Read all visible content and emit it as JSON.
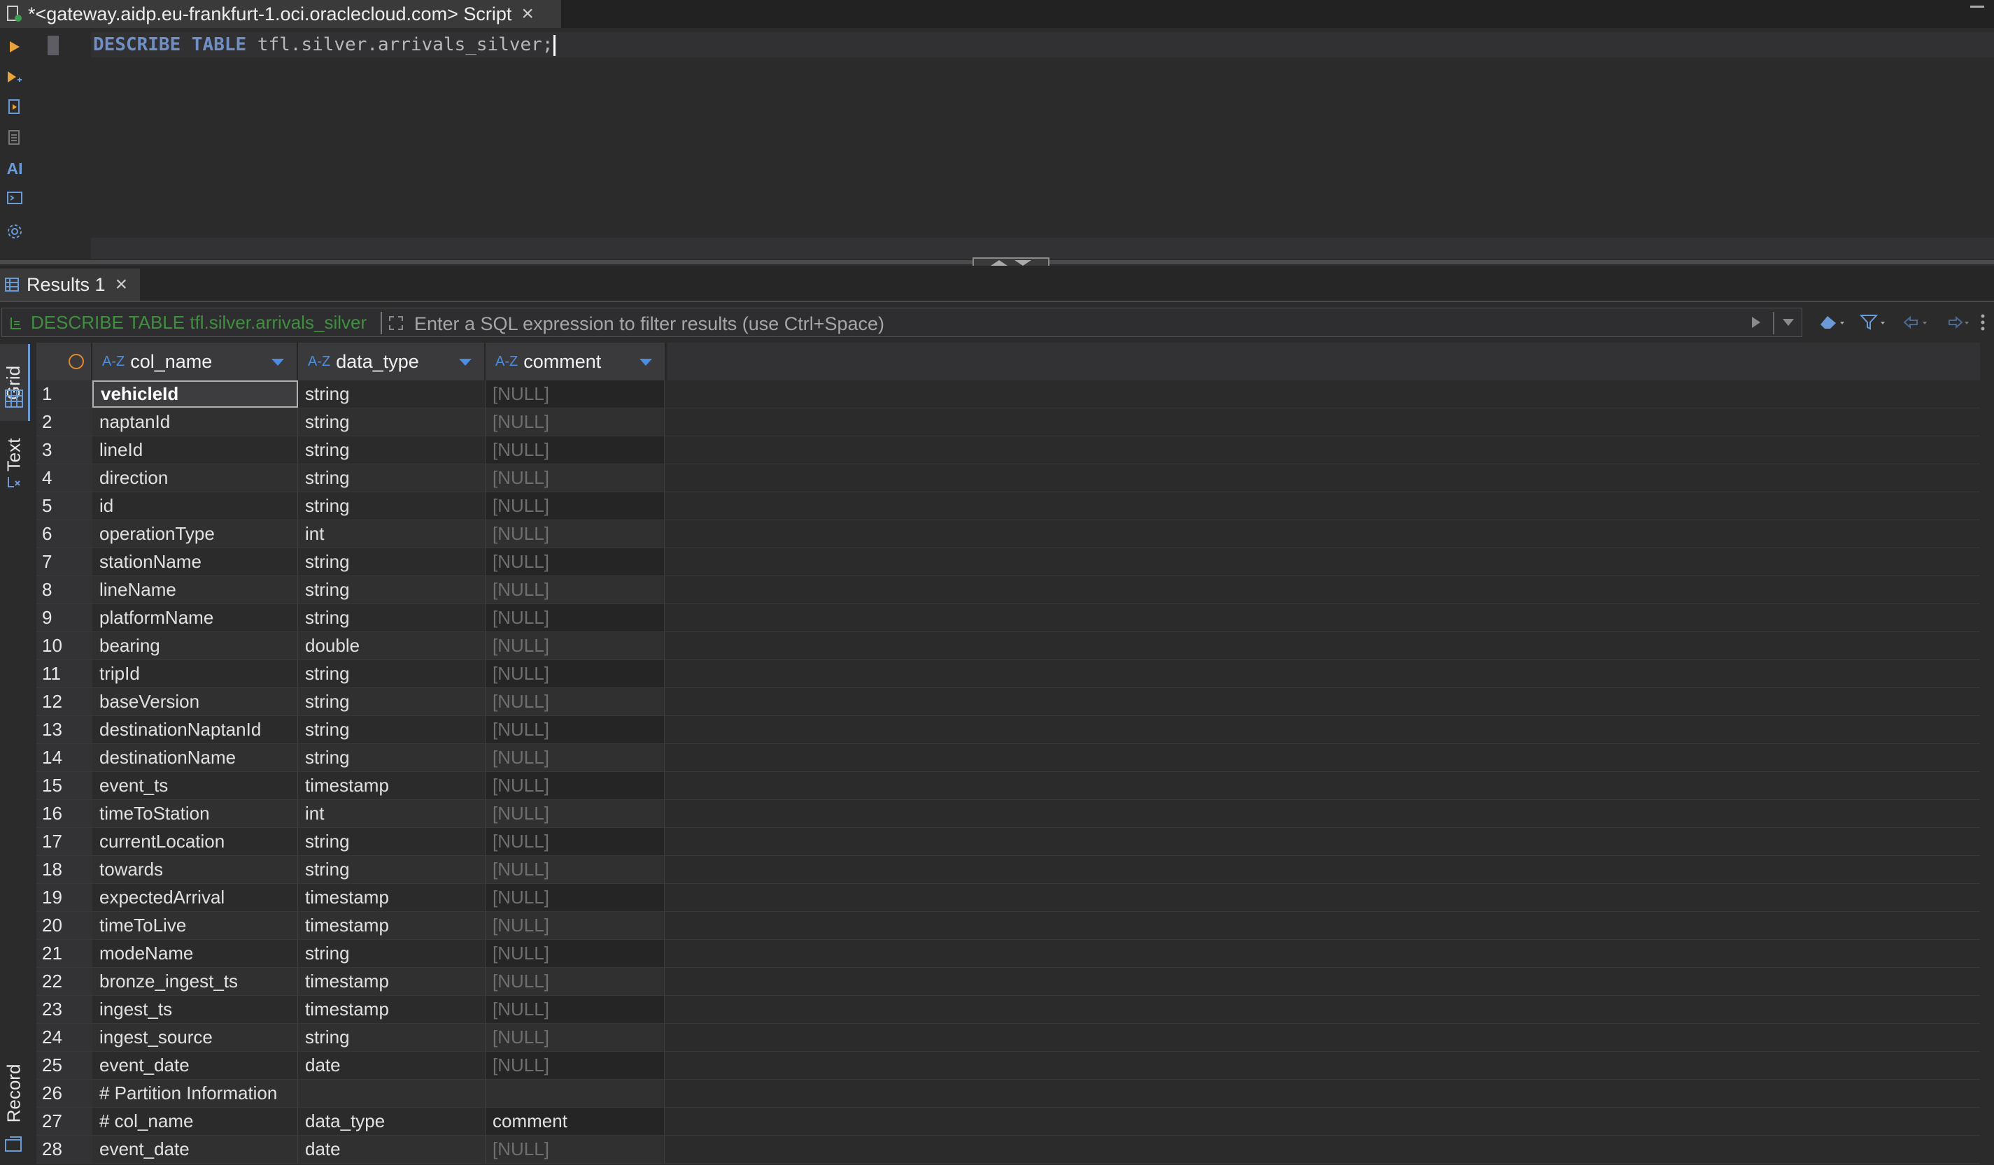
{
  "editor_tab": {
    "title": "*<gateway.aidp.eu-frankfurt-1.oci.oraclecloud.com> Script"
  },
  "editor": {
    "keyword1": "DESCRIBE",
    "keyword2": "TABLE",
    "identifier": "tfl.silver.arrivals_silver;"
  },
  "toolbar": {
    "ai_label": "AI"
  },
  "results": {
    "tab_label": "Results 1",
    "query_label": "DESCRIBE TABLE tfl.silver.arrivals_silver",
    "filter_placeholder": "Enter a SQL expression to filter results (use Ctrl+Space)"
  },
  "side_tabs": {
    "grid": "Grid",
    "text": "Text",
    "record": "Record"
  },
  "grid": {
    "columns": [
      {
        "label": "col_name",
        "type_badge": "A-Z"
      },
      {
        "label": "data_type",
        "type_badge": "A-Z"
      },
      {
        "label": "comment",
        "type_badge": "A-Z"
      }
    ],
    "rows": [
      {
        "n": "1",
        "col_name": "vehicleId",
        "data_type": "string",
        "comment": "[NULL]"
      },
      {
        "n": "2",
        "col_name": "naptanId",
        "data_type": "string",
        "comment": "[NULL]"
      },
      {
        "n": "3",
        "col_name": "lineId",
        "data_type": "string",
        "comment": "[NULL]"
      },
      {
        "n": "4",
        "col_name": "direction",
        "data_type": "string",
        "comment": "[NULL]"
      },
      {
        "n": "5",
        "col_name": "id",
        "data_type": "string",
        "comment": "[NULL]"
      },
      {
        "n": "6",
        "col_name": "operationType",
        "data_type": "int",
        "comment": "[NULL]"
      },
      {
        "n": "7",
        "col_name": "stationName",
        "data_type": "string",
        "comment": "[NULL]"
      },
      {
        "n": "8",
        "col_name": "lineName",
        "data_type": "string",
        "comment": "[NULL]"
      },
      {
        "n": "9",
        "col_name": "platformName",
        "data_type": "string",
        "comment": "[NULL]"
      },
      {
        "n": "10",
        "col_name": "bearing",
        "data_type": "double",
        "comment": "[NULL]"
      },
      {
        "n": "11",
        "col_name": "tripId",
        "data_type": "string",
        "comment": "[NULL]"
      },
      {
        "n": "12",
        "col_name": "baseVersion",
        "data_type": "string",
        "comment": "[NULL]"
      },
      {
        "n": "13",
        "col_name": "destinationNaptanId",
        "data_type": "string",
        "comment": "[NULL]"
      },
      {
        "n": "14",
        "col_name": "destinationName",
        "data_type": "string",
        "comment": "[NULL]"
      },
      {
        "n": "15",
        "col_name": "event_ts",
        "data_type": "timestamp",
        "comment": "[NULL]"
      },
      {
        "n": "16",
        "col_name": "timeToStation",
        "data_type": "int",
        "comment": "[NULL]"
      },
      {
        "n": "17",
        "col_name": "currentLocation",
        "data_type": "string",
        "comment": "[NULL]"
      },
      {
        "n": "18",
        "col_name": "towards",
        "data_type": "string",
        "comment": "[NULL]"
      },
      {
        "n": "19",
        "col_name": "expectedArrival",
        "data_type": "timestamp",
        "comment": "[NULL]"
      },
      {
        "n": "20",
        "col_name": "timeToLive",
        "data_type": "timestamp",
        "comment": "[NULL]"
      },
      {
        "n": "21",
        "col_name": "modeName",
        "data_type": "string",
        "comment": "[NULL]"
      },
      {
        "n": "22",
        "col_name": "bronze_ingest_ts",
        "data_type": "timestamp",
        "comment": "[NULL]"
      },
      {
        "n": "23",
        "col_name": "ingest_ts",
        "data_type": "timestamp",
        "comment": "[NULL]"
      },
      {
        "n": "24",
        "col_name": "ingest_source",
        "data_type": "string",
        "comment": "[NULL]"
      },
      {
        "n": "25",
        "col_name": "event_date",
        "data_type": "date",
        "comment": "[NULL]"
      },
      {
        "n": "26",
        "col_name": "# Partition Information",
        "data_type": "",
        "comment": ""
      },
      {
        "n": "27",
        "col_name": "# col_name",
        "data_type": "data_type",
        "comment": "comment"
      },
      {
        "n": "28",
        "col_name": "event_date",
        "data_type": "date",
        "comment": "[NULL]"
      }
    ]
  },
  "colors": {
    "accent": "#4d8de0",
    "query_green": "#3f8f3f",
    "null_gray": "#6f6f6f"
  }
}
